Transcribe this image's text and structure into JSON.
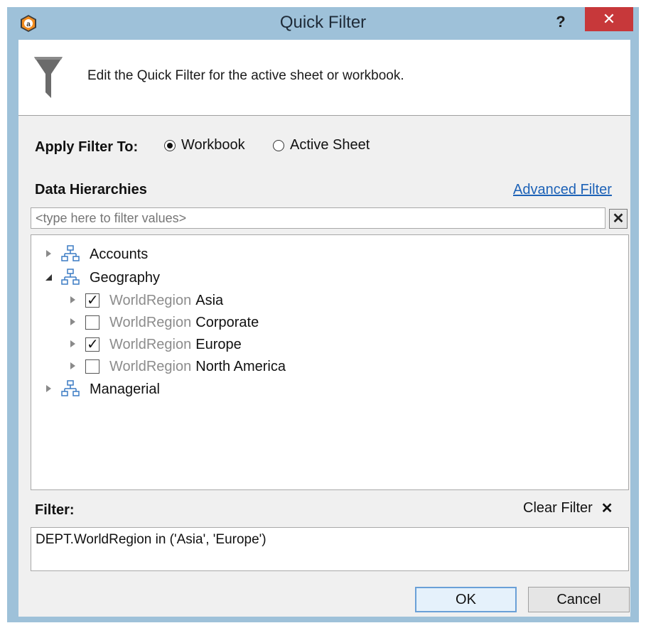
{
  "window": {
    "title": "Quick Filter",
    "help_label": "?",
    "close_label": "✕"
  },
  "header": {
    "description": "Edit the Quick Filter for the active sheet or workbook."
  },
  "apply_filter": {
    "label": "Apply Filter To:",
    "options": [
      {
        "label": "Workbook",
        "selected": true
      },
      {
        "label": "Active Sheet",
        "selected": false
      }
    ]
  },
  "hierarchies": {
    "label": "Data Hierarchies",
    "advanced_link": "Advanced Filter",
    "search_placeholder": "<type here to filter values>",
    "clear_search": "✕",
    "tree": [
      {
        "label": "Accounts",
        "expanded": false
      },
      {
        "label": "Geography",
        "expanded": true,
        "children": [
          {
            "prefix": "WorldRegion",
            "label": "Asia",
            "checked": true
          },
          {
            "prefix": "WorldRegion",
            "label": "Corporate",
            "checked": false
          },
          {
            "prefix": "WorldRegion",
            "label": "Europe",
            "checked": true
          },
          {
            "prefix": "WorldRegion",
            "label": "North America",
            "checked": false
          }
        ]
      },
      {
        "label": "Managerial",
        "expanded": false
      }
    ]
  },
  "filter": {
    "label": "Filter:",
    "clear_label": "Clear Filter",
    "clear_icon": "✕",
    "expression": "DEPT.WorldRegion in ('Asia', 'Europe')"
  },
  "buttons": {
    "ok": "OK",
    "cancel": "Cancel"
  },
  "icons": {
    "app": "app-logo-icon",
    "funnel": "funnel-icon",
    "hierarchy": "hierarchy-icon"
  }
}
